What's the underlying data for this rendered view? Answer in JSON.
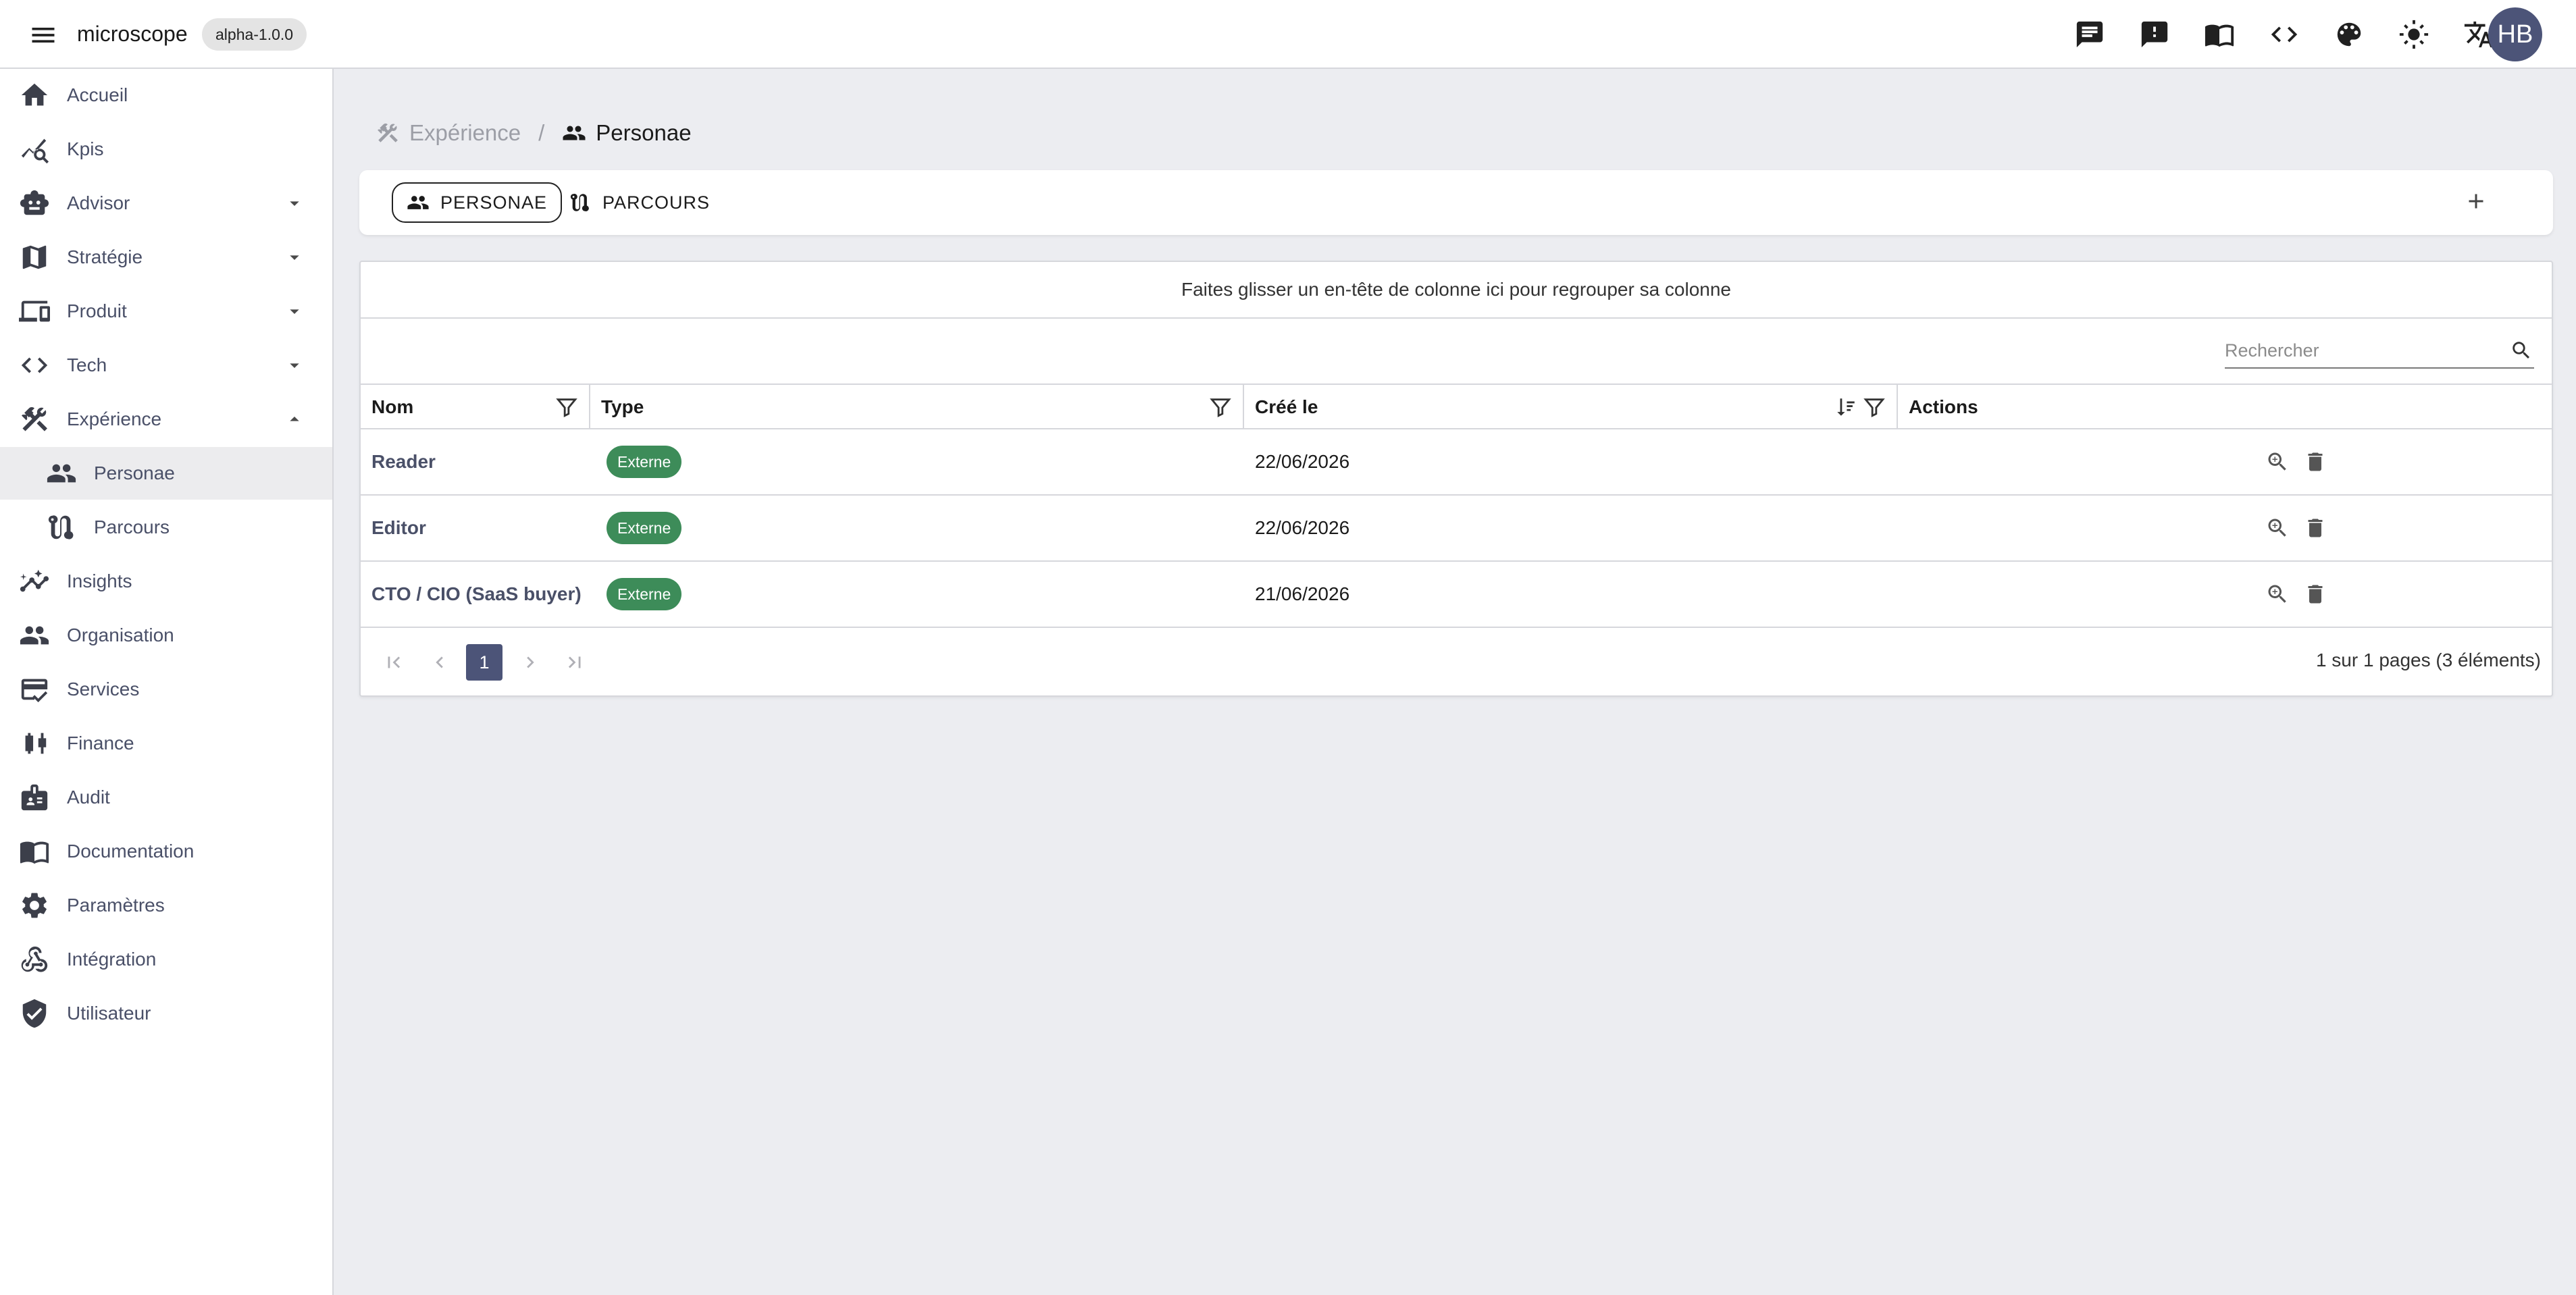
{
  "app": {
    "brand": "microscope",
    "version": "alpha-1.0.0",
    "user_initials": "HB",
    "top_icons": [
      "chat-icon",
      "feedback-icon",
      "book-icon",
      "code-icon",
      "palette-icon",
      "brightness-icon",
      "translate-icon"
    ]
  },
  "sidebar": {
    "items": [
      {
        "label": "Accueil",
        "icon": "home-icon"
      },
      {
        "label": "Kpis",
        "icon": "kpi-chart-icon"
      },
      {
        "label": "Advisor",
        "icon": "robot-icon",
        "expandable": true
      },
      {
        "label": "Stratégie",
        "icon": "map-icon",
        "expandable": true
      },
      {
        "label": "Produit",
        "icon": "devices-icon",
        "expandable": true
      },
      {
        "label": "Tech",
        "icon": "code-icon",
        "expandable": true
      },
      {
        "label": "Expérience",
        "icon": "design-tools-icon",
        "expandable": true,
        "expanded": true
      },
      {
        "label": "Personae",
        "icon": "people-icon",
        "sub": true,
        "active": true
      },
      {
        "label": "Parcours",
        "icon": "route-icon",
        "sub": true
      },
      {
        "label": "Insights",
        "icon": "insights-icon"
      },
      {
        "label": "Organisation",
        "icon": "groups-icon"
      },
      {
        "label": "Services",
        "icon": "services-icon"
      },
      {
        "label": "Finance",
        "icon": "candlestick-icon"
      },
      {
        "label": "Audit",
        "icon": "badge-icon"
      },
      {
        "label": "Documentation",
        "icon": "book-icon"
      },
      {
        "label": "Paramètres",
        "icon": "gear-icon"
      },
      {
        "label": "Intégration",
        "icon": "webhook-icon"
      },
      {
        "label": "Utilisateur",
        "icon": "shield-check-icon"
      }
    ]
  },
  "breadcrumb": {
    "parent": "Expérience",
    "current": "Personae"
  },
  "tabs": [
    {
      "label": "PERSONAE",
      "selected": true
    },
    {
      "label": "PARCOURS",
      "selected": false
    }
  ],
  "grid": {
    "group_panel_text": "Faites glisser un en-tête de colonne ici pour regrouper sa colonne",
    "search_placeholder": "Rechercher",
    "columns": {
      "name": "Nom",
      "type": "Type",
      "created": "Créé le",
      "actions": "Actions"
    },
    "rows": [
      {
        "name": "Reader",
        "type": "Externe",
        "created": "22/06/2026"
      },
      {
        "name": "Editor",
        "type": "Externe",
        "created": "22/06/2026"
      },
      {
        "name": "CTO / CIO (SaaS buyer)",
        "type": "Externe",
        "created": "21/06/2026"
      }
    ],
    "pager": {
      "current_page": "1",
      "info": "1 sur 1 pages (3 éléments)"
    }
  },
  "colors": {
    "accent": "#4c5478",
    "badge_green": "#3d8c59",
    "background": "#ecedf1"
  }
}
